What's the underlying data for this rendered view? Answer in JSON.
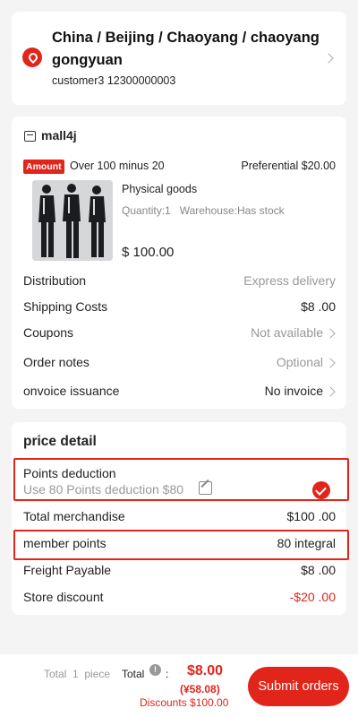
{
  "address": {
    "line": "China / Beijing / Chaoyang / chaoyanggongyuan",
    "contact": "customer3 12300000003"
  },
  "shop": {
    "name": "mall4j",
    "promo_badge": "Amount",
    "promo_text": "Over 100 minus 20",
    "preferential": "Preferential $20.00"
  },
  "product": {
    "title": "Physical goods",
    "meta": "Quantity:1   Warehouse:Has stock",
    "price": "$ 100.00"
  },
  "order_rows": [
    {
      "label": "Distribution",
      "value": "Express delivery"
    },
    {
      "label": "Shipping Costs",
      "value": "$8 .00"
    },
    {
      "label": "Coupons",
      "value": "Not available"
    },
    {
      "label": "Order notes",
      "value": "Optional"
    },
    {
      "label": "onvoice issuance",
      "value": "No invoice"
    }
  ],
  "price_detail": {
    "title": "price detail",
    "points_label": "Points deduction",
    "points_sub": "Use 80 Points deduction $80",
    "rows": [
      {
        "label": "Total merchandise",
        "value": "$100 .00"
      },
      {
        "label": "member points",
        "value": "80 integral"
      },
      {
        "label": "Freight Payable",
        "value": "$8 .00"
      },
      {
        "label": "Store discount",
        "value": "-$20 .00"
      }
    ]
  },
  "footer": {
    "total_count": "Total  1  piece",
    "total_label": "Total",
    "colon": ":",
    "amount": "$8.00",
    "amount_yen": "(¥58.08)",
    "discounts": "Discounts $100.00",
    "submit": "Submit orders"
  },
  "colors": {
    "accent": "#e1251b",
    "background": "#f4f4f4"
  }
}
